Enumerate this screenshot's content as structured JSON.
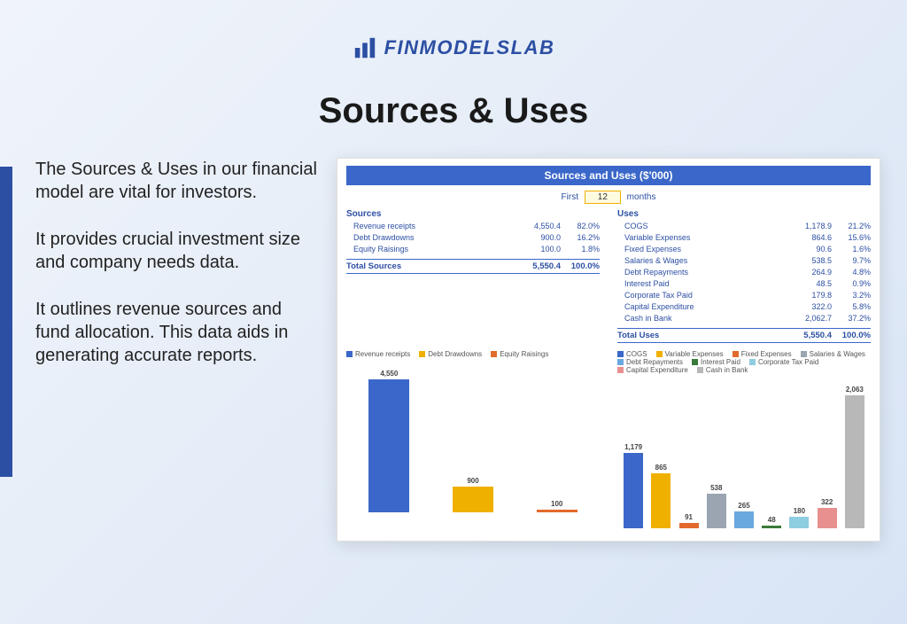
{
  "brand": "FINMODELSLAB",
  "title": "Sources & Uses",
  "paragraphs": [
    "The Sources & Uses in our financial model are vital for investors.",
    "It provides crucial investment size and company needs data.",
    "It outlines revenue sources and fund allocation. This data aids in generating accurate reports."
  ],
  "panel": {
    "title": "Sources and Uses ($'000)",
    "period_prefix": "First",
    "period_value": "12",
    "period_suffix": "months"
  },
  "sources": {
    "heading": "Sources",
    "rows": [
      {
        "label": "Revenue receipts",
        "value": "4,550.4",
        "pct": "82.0%"
      },
      {
        "label": "Debt Drawdowns",
        "value": "900.0",
        "pct": "16.2%"
      },
      {
        "label": "Equity Raisings",
        "value": "100.0",
        "pct": "1.8%"
      }
    ],
    "total_label": "Total Sources",
    "total_value": "5,550.4",
    "total_pct": "100.0%"
  },
  "uses": {
    "heading": "Uses",
    "rows": [
      {
        "label": "COGS",
        "value": "1,178.9",
        "pct": "21.2%"
      },
      {
        "label": "Variable Expenses",
        "value": "864.6",
        "pct": "15.6%"
      },
      {
        "label": "Fixed Expenses",
        "value": "90.6",
        "pct": "1.6%"
      },
      {
        "label": "Salaries & Wages",
        "value": "538.5",
        "pct": "9.7%"
      },
      {
        "label": "Debt Repayments",
        "value": "264.9",
        "pct": "4.8%"
      },
      {
        "label": "Interest Paid",
        "value": "48.5",
        "pct": "0.9%"
      },
      {
        "label": "Corporate Tax Paid",
        "value": "179.8",
        "pct": "3.2%"
      },
      {
        "label": "Capital Expenditure",
        "value": "322.0",
        "pct": "5.8%"
      },
      {
        "label": "Cash in Bank",
        "value": "2,062.7",
        "pct": "37.2%"
      }
    ],
    "total_label": "Total Uses",
    "total_value": "5,550.4",
    "total_pct": "100.0%"
  },
  "chart_data": [
    {
      "type": "bar",
      "title": "Sources",
      "categories": [
        "Revenue receipts",
        "Debt Drawdowns",
        "Equity Raisings"
      ],
      "values": [
        4550,
        900,
        100
      ],
      "labels": [
        "4,550",
        "900",
        "100"
      ],
      "colors": [
        "#3a67c9",
        "#f0b000",
        "#e36a2d"
      ],
      "ylim": [
        0,
        4550
      ]
    },
    {
      "type": "bar",
      "title": "Uses",
      "categories": [
        "COGS",
        "Variable Expenses",
        "Fixed Expenses",
        "Salaries & Wages",
        "Debt Repayments",
        "Interest Paid",
        "Corporate Tax Paid",
        "Capital Expenditure",
        "Cash in Bank"
      ],
      "values": [
        1179,
        865,
        91,
        538,
        265,
        48,
        180,
        322,
        2063
      ],
      "labels": [
        "1,179",
        "865",
        "91",
        "538",
        "265",
        "48",
        "180",
        "322",
        "2,063"
      ],
      "colors": [
        "#3a67c9",
        "#f0b000",
        "#e36a2d",
        "#9aa5b1",
        "#6aa8e0",
        "#3a7a3a",
        "#8fcde0",
        "#e89090",
        "#b8b8b8"
      ],
      "ylim": [
        0,
        2063
      ]
    }
  ]
}
